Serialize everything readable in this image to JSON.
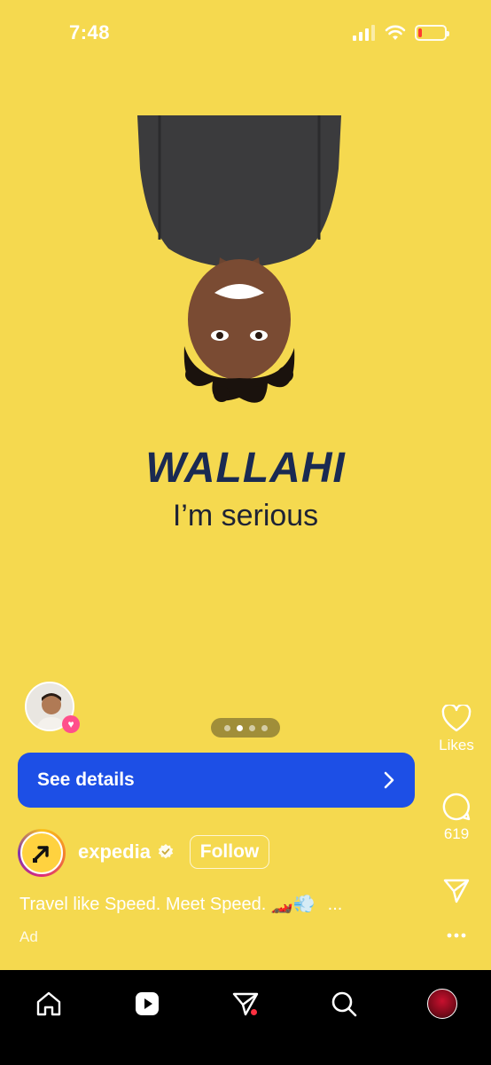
{
  "status_bar": {
    "time": "7:48"
  },
  "post": {
    "headline": "WALLAHI",
    "subline": "I’m serious",
    "carousel": {
      "total": 4,
      "active_index": 1
    },
    "cta_label": "See details",
    "account": {
      "name": "expedia",
      "verified": true,
      "follow_label": "Follow"
    },
    "caption": "Travel like Speed. Meet Speed. 🏎️💨",
    "caption_more": "...",
    "ad_label": "Ad"
  },
  "rail": {
    "likes_label": "Likes",
    "comments_count": "619"
  },
  "colors": {
    "background": "#f5d94f",
    "cta": "#1d4fe6",
    "headline": "#1a2a52",
    "nav": "#000000"
  },
  "nav": {
    "items": [
      "home-icon",
      "reels-icon",
      "messages-icon",
      "search-icon",
      "profile-avatar"
    ]
  }
}
